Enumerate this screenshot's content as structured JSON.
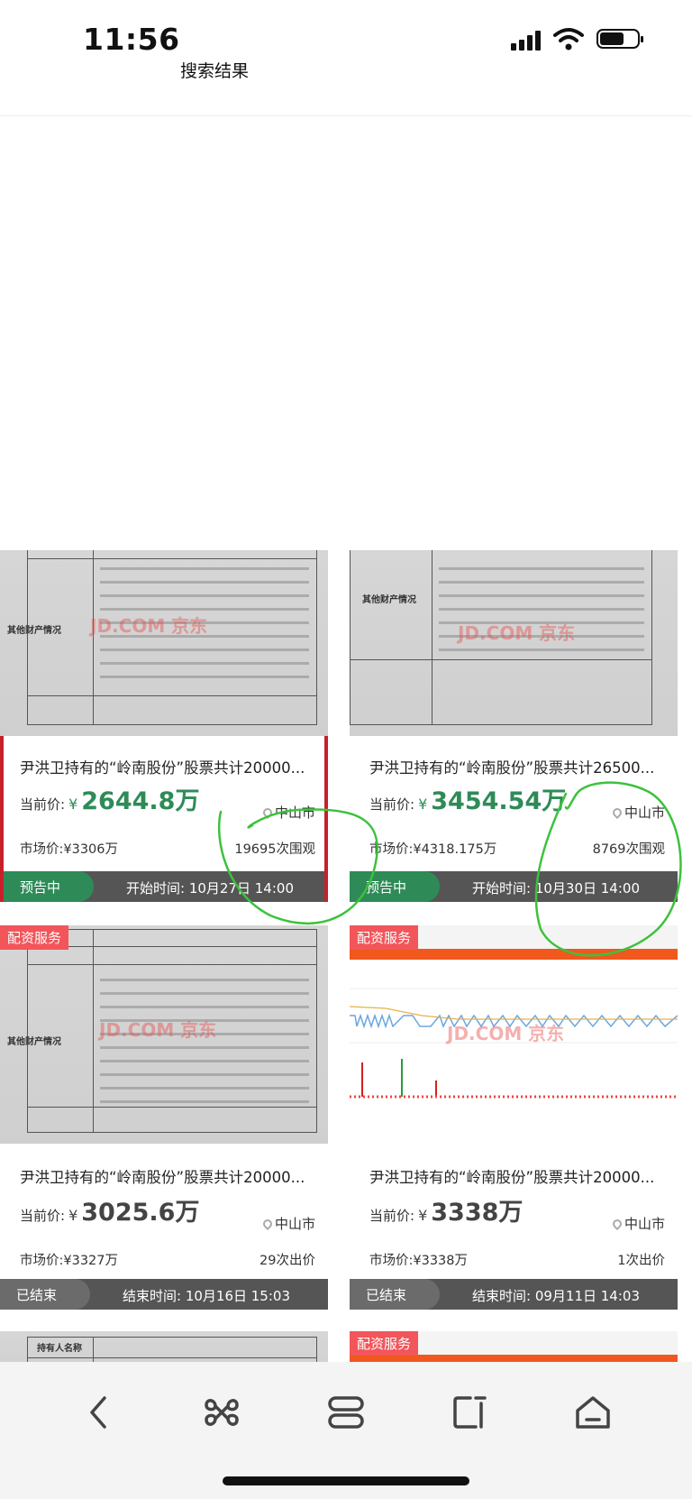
{
  "status_bar": {
    "time": "11:56"
  },
  "header": {
    "title": "搜索结果"
  },
  "cards": [
    {
      "service_tag": "",
      "title": "尹洪卫持有的“岭南股份”股票共计20000...",
      "price_label": "当前价:",
      "currency": "¥",
      "price": "2644.8万",
      "city": "中山市",
      "market_price": "市场价:¥3306万",
      "views": "19695次围观",
      "status": "预告中",
      "time_text": "开始时间:  10月27日 14:00",
      "watermark": "JD.COM 京东",
      "doc_label": "其他财产情况"
    },
    {
      "service_tag": "",
      "title": "尹洪卫持有的“岭南股份”股票共计26500...",
      "price_label": "当前价:",
      "currency": "¥",
      "price": "3454.54万",
      "city": "中山市",
      "market_price": "市场价:¥4318.175万",
      "views": "8769次围观",
      "status": "预告中",
      "time_text": "开始时间:  10月30日 14:00",
      "watermark": "JD.COM 京东",
      "doc_label": "其他财产情况"
    },
    {
      "service_tag": "配资服务",
      "title": "尹洪卫持有的“岭南股份”股票共计20000...",
      "price_label": "当前价:",
      "currency": "¥",
      "price": "3025.6万",
      "city": "中山市",
      "market_price": "市场价:¥3327万",
      "views": "29次出价",
      "status": "已结束",
      "time_text": "结束时间:  10月16日 15:03",
      "watermark": "JD.COM 京东",
      "doc_label": "其他财产情况"
    },
    {
      "service_tag": "配资服务",
      "title": "尹洪卫持有的“岭南股份”股票共计20000...",
      "price_label": "当前价:",
      "currency": "¥",
      "price": "3338万",
      "city": "中山市",
      "market_price": "市场价:¥3338万",
      "views": "1次出价",
      "status": "已结束",
      "time_text": "结束时间:  09月11日 14:03",
      "watermark": "JD.COM 京东",
      "doc_label": ""
    },
    {
      "service_tag": "",
      "title": "",
      "doc_label": "持有人名称"
    },
    {
      "service_tag": "配资服务",
      "title": ""
    }
  ],
  "bottom_nav": [
    "back-icon",
    "command-icon",
    "tabs-icon",
    "share-icon",
    "home-icon"
  ],
  "colors": {
    "accent_green": "#2e8b57",
    "selected_border": "#c8202a",
    "service_tag": "#f2555a",
    "annotation": "#3cc23c"
  }
}
